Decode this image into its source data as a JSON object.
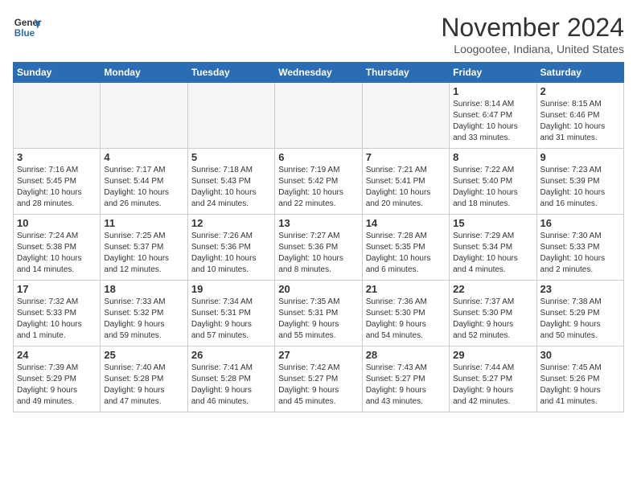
{
  "logo": {
    "line1": "General",
    "line2": "Blue"
  },
  "title": "November 2024",
  "location": "Loogootee, Indiana, United States",
  "days_of_week": [
    "Sunday",
    "Monday",
    "Tuesday",
    "Wednesday",
    "Thursday",
    "Friday",
    "Saturday"
  ],
  "weeks": [
    [
      {
        "day": "",
        "info": "",
        "empty": true
      },
      {
        "day": "",
        "info": "",
        "empty": true
      },
      {
        "day": "",
        "info": "",
        "empty": true
      },
      {
        "day": "",
        "info": "",
        "empty": true
      },
      {
        "day": "",
        "info": "",
        "empty": true
      },
      {
        "day": "1",
        "info": "Sunrise: 8:14 AM\nSunset: 6:47 PM\nDaylight: 10 hours\nand 33 minutes."
      },
      {
        "day": "2",
        "info": "Sunrise: 8:15 AM\nSunset: 6:46 PM\nDaylight: 10 hours\nand 31 minutes."
      }
    ],
    [
      {
        "day": "3",
        "info": "Sunrise: 7:16 AM\nSunset: 5:45 PM\nDaylight: 10 hours\nand 28 minutes."
      },
      {
        "day": "4",
        "info": "Sunrise: 7:17 AM\nSunset: 5:44 PM\nDaylight: 10 hours\nand 26 minutes."
      },
      {
        "day": "5",
        "info": "Sunrise: 7:18 AM\nSunset: 5:43 PM\nDaylight: 10 hours\nand 24 minutes."
      },
      {
        "day": "6",
        "info": "Sunrise: 7:19 AM\nSunset: 5:42 PM\nDaylight: 10 hours\nand 22 minutes."
      },
      {
        "day": "7",
        "info": "Sunrise: 7:21 AM\nSunset: 5:41 PM\nDaylight: 10 hours\nand 20 minutes."
      },
      {
        "day": "8",
        "info": "Sunrise: 7:22 AM\nSunset: 5:40 PM\nDaylight: 10 hours\nand 18 minutes."
      },
      {
        "day": "9",
        "info": "Sunrise: 7:23 AM\nSunset: 5:39 PM\nDaylight: 10 hours\nand 16 minutes."
      }
    ],
    [
      {
        "day": "10",
        "info": "Sunrise: 7:24 AM\nSunset: 5:38 PM\nDaylight: 10 hours\nand 14 minutes."
      },
      {
        "day": "11",
        "info": "Sunrise: 7:25 AM\nSunset: 5:37 PM\nDaylight: 10 hours\nand 12 minutes."
      },
      {
        "day": "12",
        "info": "Sunrise: 7:26 AM\nSunset: 5:36 PM\nDaylight: 10 hours\nand 10 minutes."
      },
      {
        "day": "13",
        "info": "Sunrise: 7:27 AM\nSunset: 5:36 PM\nDaylight: 10 hours\nand 8 minutes."
      },
      {
        "day": "14",
        "info": "Sunrise: 7:28 AM\nSunset: 5:35 PM\nDaylight: 10 hours\nand 6 minutes."
      },
      {
        "day": "15",
        "info": "Sunrise: 7:29 AM\nSunset: 5:34 PM\nDaylight: 10 hours\nand 4 minutes."
      },
      {
        "day": "16",
        "info": "Sunrise: 7:30 AM\nSunset: 5:33 PM\nDaylight: 10 hours\nand 2 minutes."
      }
    ],
    [
      {
        "day": "17",
        "info": "Sunrise: 7:32 AM\nSunset: 5:33 PM\nDaylight: 10 hours\nand 1 minute."
      },
      {
        "day": "18",
        "info": "Sunrise: 7:33 AM\nSunset: 5:32 PM\nDaylight: 9 hours\nand 59 minutes."
      },
      {
        "day": "19",
        "info": "Sunrise: 7:34 AM\nSunset: 5:31 PM\nDaylight: 9 hours\nand 57 minutes."
      },
      {
        "day": "20",
        "info": "Sunrise: 7:35 AM\nSunset: 5:31 PM\nDaylight: 9 hours\nand 55 minutes."
      },
      {
        "day": "21",
        "info": "Sunrise: 7:36 AM\nSunset: 5:30 PM\nDaylight: 9 hours\nand 54 minutes."
      },
      {
        "day": "22",
        "info": "Sunrise: 7:37 AM\nSunset: 5:30 PM\nDaylight: 9 hours\nand 52 minutes."
      },
      {
        "day": "23",
        "info": "Sunrise: 7:38 AM\nSunset: 5:29 PM\nDaylight: 9 hours\nand 50 minutes."
      }
    ],
    [
      {
        "day": "24",
        "info": "Sunrise: 7:39 AM\nSunset: 5:29 PM\nDaylight: 9 hours\nand 49 minutes."
      },
      {
        "day": "25",
        "info": "Sunrise: 7:40 AM\nSunset: 5:28 PM\nDaylight: 9 hours\nand 47 minutes."
      },
      {
        "day": "26",
        "info": "Sunrise: 7:41 AM\nSunset: 5:28 PM\nDaylight: 9 hours\nand 46 minutes."
      },
      {
        "day": "27",
        "info": "Sunrise: 7:42 AM\nSunset: 5:27 PM\nDaylight: 9 hours\nand 45 minutes."
      },
      {
        "day": "28",
        "info": "Sunrise: 7:43 AM\nSunset: 5:27 PM\nDaylight: 9 hours\nand 43 minutes."
      },
      {
        "day": "29",
        "info": "Sunrise: 7:44 AM\nSunset: 5:27 PM\nDaylight: 9 hours\nand 42 minutes."
      },
      {
        "day": "30",
        "info": "Sunrise: 7:45 AM\nSunset: 5:26 PM\nDaylight: 9 hours\nand 41 minutes."
      }
    ]
  ]
}
